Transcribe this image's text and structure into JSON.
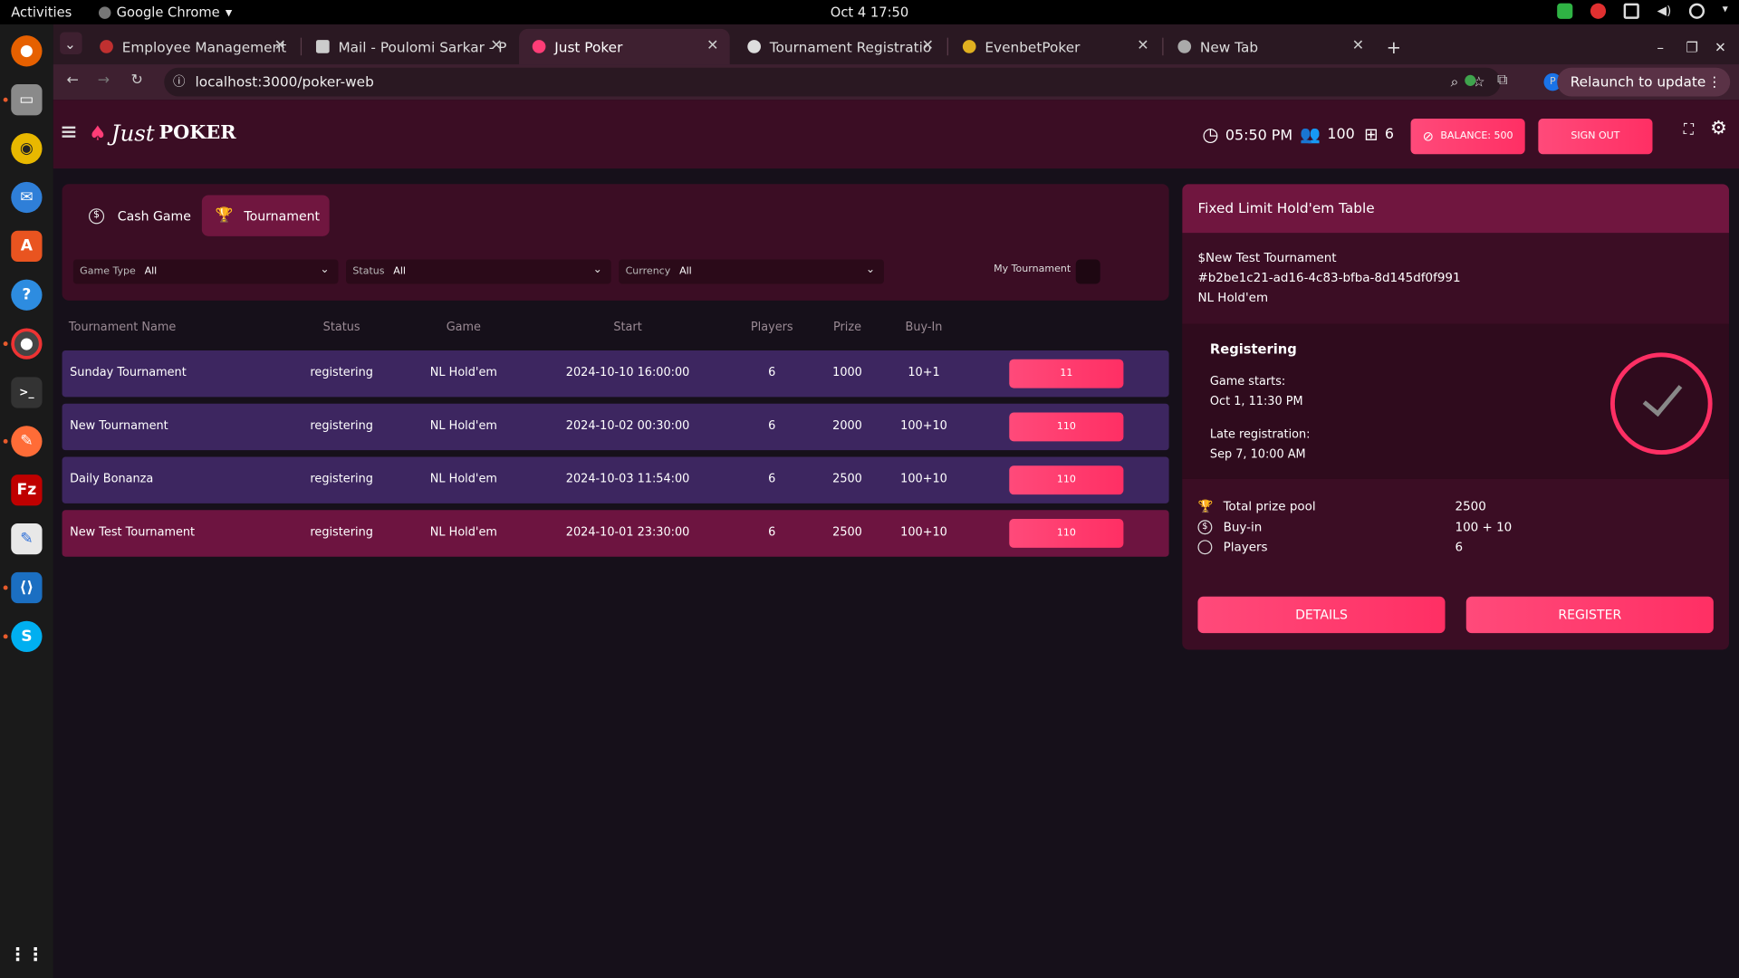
{
  "os": {
    "activities": "Activities",
    "app_name": "Google Chrome",
    "clock": "Oct 4  17:50"
  },
  "browser": {
    "tabs": [
      {
        "label": "Employee Management"
      },
      {
        "label": "Mail - Poulomi Sarkar - P"
      },
      {
        "label": "Just Poker"
      },
      {
        "label": "Tournament Registratio"
      },
      {
        "label": "EvenbetPoker"
      },
      {
        "label": "New Tab"
      }
    ],
    "url": "localhost:3000/poker-web",
    "relaunch": "Relaunch to update",
    "profile_initial": "P"
  },
  "header": {
    "logo_script": "Just",
    "logo_bold": "POKER",
    "time": "05:50 PM",
    "players": "100",
    "tables": "6",
    "balance": "BALANCE: 500",
    "signout": "SIGN OUT"
  },
  "modes": {
    "cash": "Cash Game",
    "tournament": "Tournament"
  },
  "filters": {
    "game_type_label": "Game Type",
    "game_type_value": "All",
    "status_label": "Status",
    "status_value": "All",
    "currency_label": "Currency",
    "currency_value": "All",
    "my_tournament": "My Tournament"
  },
  "table": {
    "headers": [
      "Tournament Name",
      "Status",
      "Game",
      "Start",
      "Players",
      "Prize",
      "Buy-In"
    ],
    "rows": [
      {
        "name": "Sunday Tournament",
        "status": "registering",
        "game": "NL Hold'em",
        "start": "2024-10-10 16:00:00",
        "players": "6",
        "prize": "1000",
        "buyin": "10+1",
        "button": "11"
      },
      {
        "name": "New Tournament",
        "status": "registering",
        "game": "NL Hold'em",
        "start": "2024-10-02 00:30:00",
        "players": "6",
        "prize": "2000",
        "buyin": "100+10",
        "button": "110"
      },
      {
        "name": "Daily Bonanza",
        "status": "registering",
        "game": "NL Hold'em",
        "start": "2024-10-03 11:54:00",
        "players": "6",
        "prize": "2500",
        "buyin": "100+10",
        "button": "110"
      },
      {
        "name": "New Test Tournament",
        "status": "registering",
        "game": "NL Hold'em",
        "start": "2024-10-01 23:30:00",
        "players": "6",
        "prize": "2500",
        "buyin": "100+10",
        "button": "110"
      }
    ]
  },
  "detail": {
    "title": "Fixed Limit Hold'em Table",
    "name": "$New Test Tournament",
    "id": "#b2be1c21-ad16-4c83-bfba-8d145df0f991",
    "game": "NL Hold'em",
    "status": "Registering",
    "starts_label": "Game starts:",
    "starts_value": "Oct 1, 11:30 PM",
    "late_label": "Late registration:",
    "late_value": "Sep 7, 10:00 AM",
    "prize_label": "Total prize pool",
    "prize_value": "2500",
    "buyin_label": "Buy-in",
    "buyin_value": "100 + 10",
    "players_label": "Players",
    "players_value": "6",
    "details_btn": "DETAILS",
    "register_btn": "REGISTER"
  },
  "colors": {
    "accent": "#ff2f64",
    "header_bg": "#3b0d24",
    "row_purple": "#3d2660",
    "row_selected": "#6d1440"
  }
}
